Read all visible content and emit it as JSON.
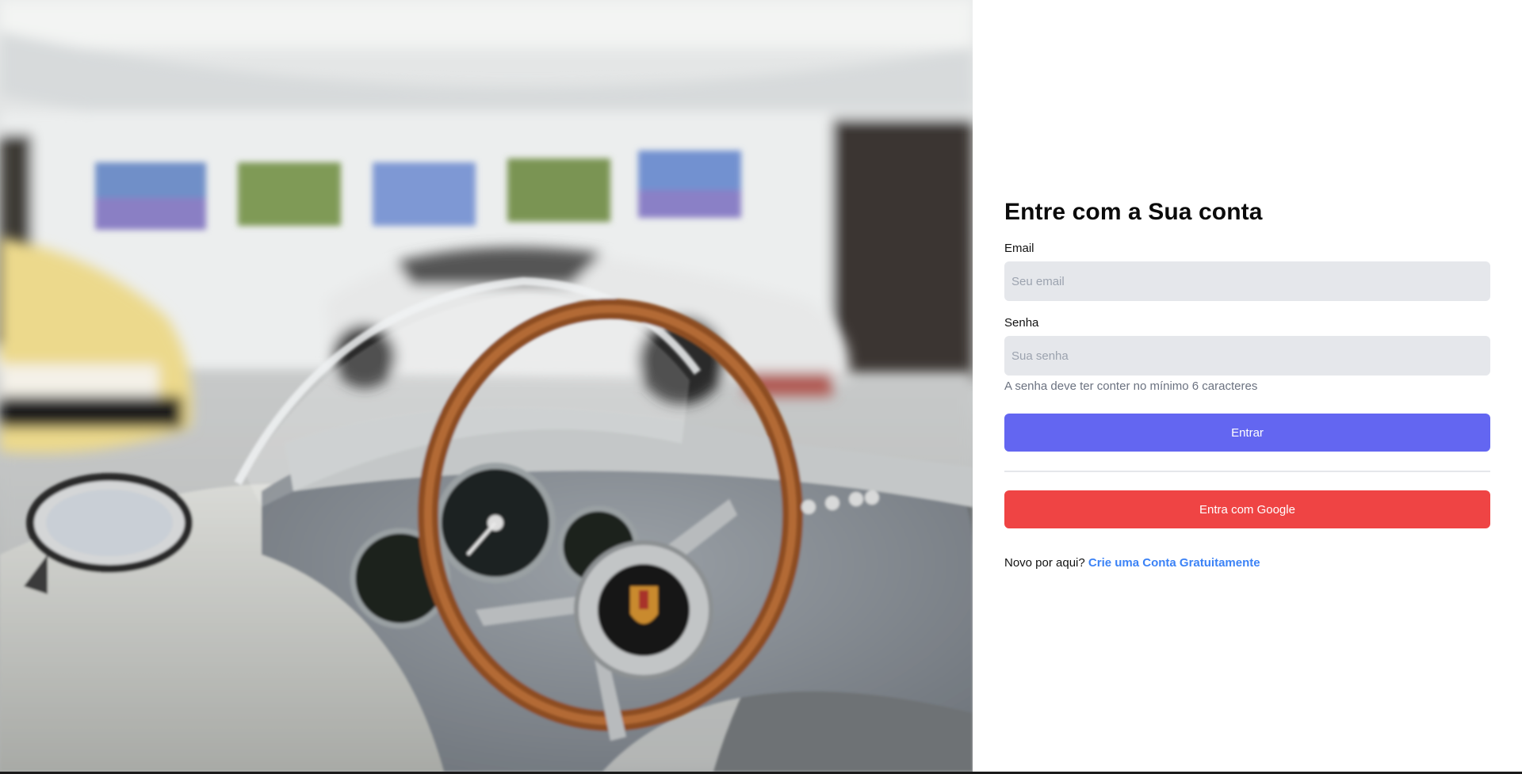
{
  "hero": {
    "image_description_icon": "vintage-car-showroom-image"
  },
  "login": {
    "title": "Entre com a Sua conta",
    "email_label": "Email",
    "email_placeholder": "Seu email",
    "email_value": "",
    "password_label": "Senha",
    "password_placeholder": "Sua senha",
    "password_value": "",
    "password_hint": "A senha deve ter conter no mínimo 6 caracteres",
    "submit_label": "Entrar",
    "google_label": "Entra com Google",
    "signup_prompt": "Novo por aqui?",
    "signup_link": "Crie uma Conta Gratuitamente"
  },
  "colors": {
    "primary": "#6366f1",
    "google": "#ef4444",
    "link": "#3b82f6",
    "input_bg": "#e5e7eb"
  }
}
